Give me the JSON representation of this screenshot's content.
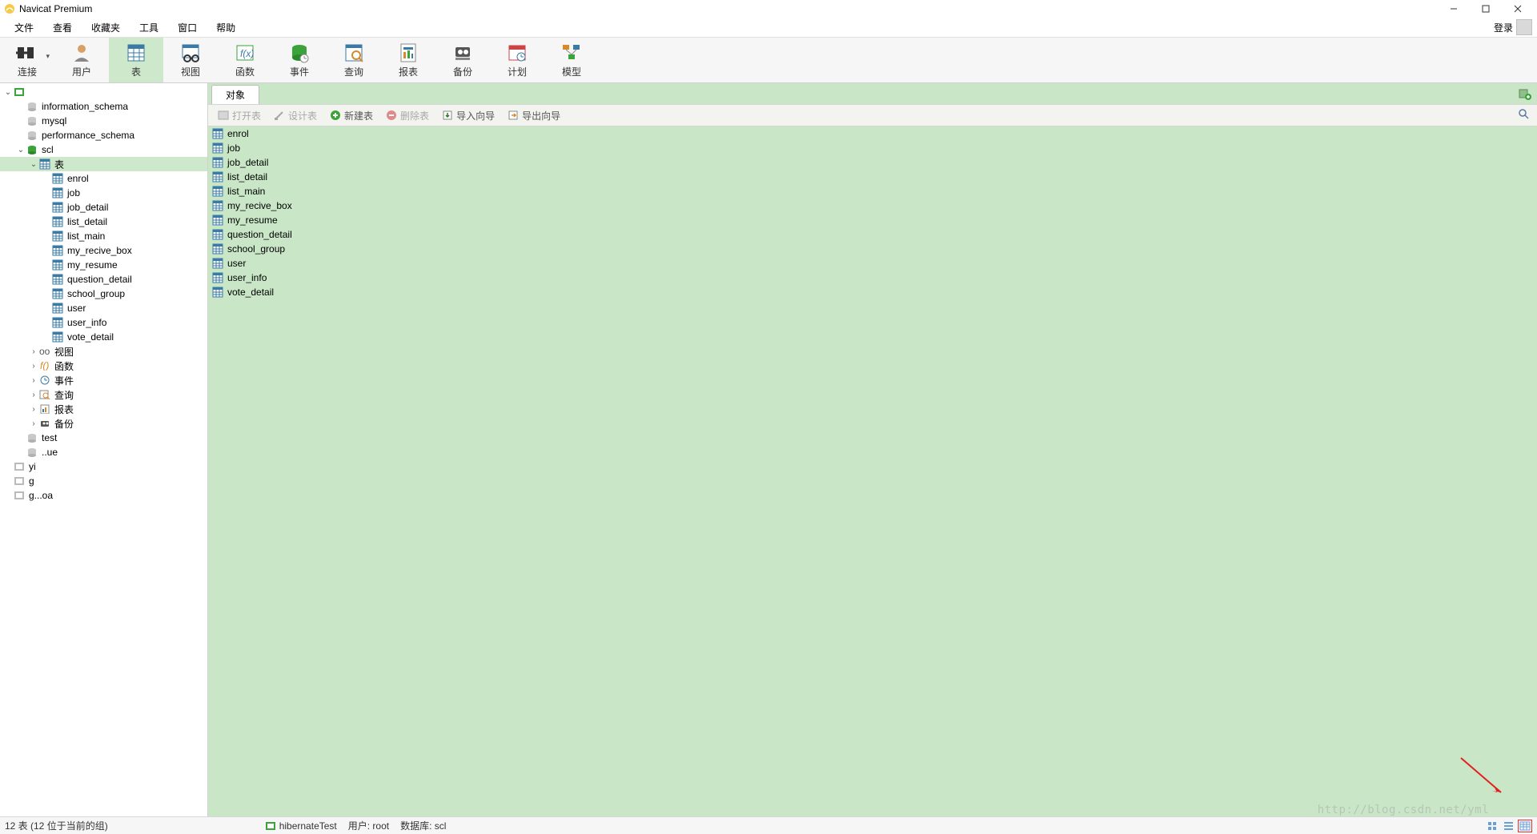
{
  "app": {
    "title": "Navicat Premium",
    "login": "登录"
  },
  "menu": [
    "文件",
    "查看",
    "收藏夹",
    "工具",
    "窗口",
    "帮助"
  ],
  "toolbar": [
    {
      "key": "connect",
      "label": "连接",
      "dropdown": true
    },
    {
      "key": "user",
      "label": "用户"
    },
    {
      "key": "table",
      "label": "表",
      "active": true
    },
    {
      "key": "view",
      "label": "视图"
    },
    {
      "key": "func",
      "label": "函数"
    },
    {
      "key": "event",
      "label": "事件"
    },
    {
      "key": "query",
      "label": "查询"
    },
    {
      "key": "report",
      "label": "报表"
    },
    {
      "key": "backup",
      "label": "备份"
    },
    {
      "key": "plan",
      "label": "计划"
    },
    {
      "key": "model",
      "label": "模型"
    }
  ],
  "tree": [
    {
      "depth": 0,
      "icon": "conn-green",
      "label": "",
      "expand": "open"
    },
    {
      "depth": 1,
      "icon": "db-gray",
      "label": "information_schema"
    },
    {
      "depth": 1,
      "icon": "db-gray",
      "label": "mysql"
    },
    {
      "depth": 1,
      "icon": "db-gray",
      "label": "performance_schema"
    },
    {
      "depth": 1,
      "icon": "db-green",
      "label": "scl",
      "expand": "open"
    },
    {
      "depth": 2,
      "icon": "table-group",
      "label": "表",
      "expand": "open",
      "selected": true
    },
    {
      "depth": 3,
      "icon": "table",
      "label": "enrol"
    },
    {
      "depth": 3,
      "icon": "table",
      "label": "job"
    },
    {
      "depth": 3,
      "icon": "table",
      "label": "job_detail"
    },
    {
      "depth": 3,
      "icon": "table",
      "label": "list_detail"
    },
    {
      "depth": 3,
      "icon": "table",
      "label": "list_main"
    },
    {
      "depth": 3,
      "icon": "table",
      "label": "my_recive_box"
    },
    {
      "depth": 3,
      "icon": "table",
      "label": "my_resume"
    },
    {
      "depth": 3,
      "icon": "table",
      "label": "question_detail"
    },
    {
      "depth": 3,
      "icon": "table",
      "label": "school_group"
    },
    {
      "depth": 3,
      "icon": "table",
      "label": "user"
    },
    {
      "depth": 3,
      "icon": "table",
      "label": "user_info"
    },
    {
      "depth": 3,
      "icon": "table",
      "label": "vote_detail"
    },
    {
      "depth": 2,
      "icon": "view",
      "label": "视图",
      "expand": "closed"
    },
    {
      "depth": 2,
      "icon": "func",
      "label": "函数",
      "expand": "closed"
    },
    {
      "depth": 2,
      "icon": "event",
      "label": "事件",
      "expand": "closed"
    },
    {
      "depth": 2,
      "icon": "query",
      "label": "查询",
      "expand": "closed"
    },
    {
      "depth": 2,
      "icon": "report",
      "label": "报表",
      "expand": "closed"
    },
    {
      "depth": 2,
      "icon": "backup",
      "label": "备份",
      "expand": "closed"
    },
    {
      "depth": 1,
      "icon": "db-gray",
      "label": "test"
    },
    {
      "depth": 1,
      "icon": "db-gray",
      "label": "..ue"
    },
    {
      "depth": 0,
      "icon": "conn-gray",
      "label": "yi"
    },
    {
      "depth": 0,
      "icon": "conn-gray",
      "label": "g"
    },
    {
      "depth": 0,
      "icon": "conn-gray",
      "label": "g...oa"
    }
  ],
  "tab": {
    "label": "对象"
  },
  "objbar": {
    "open": "打开表",
    "design": "设计表",
    "new": "新建表",
    "delete": "删除表",
    "import": "导入向导",
    "export": "导出向导"
  },
  "tables": [
    "enrol",
    "job",
    "job_detail",
    "list_detail",
    "list_main",
    "my_recive_box",
    "my_resume",
    "question_detail",
    "school_group",
    "user",
    "user_info",
    "vote_detail"
  ],
  "status": {
    "count": "12 表 (12 位于当前的组)",
    "conn": "hibernateTest",
    "user": "用户: root",
    "db": "数据库: scl"
  },
  "watermark": "http://blog.csdn.net/yml"
}
